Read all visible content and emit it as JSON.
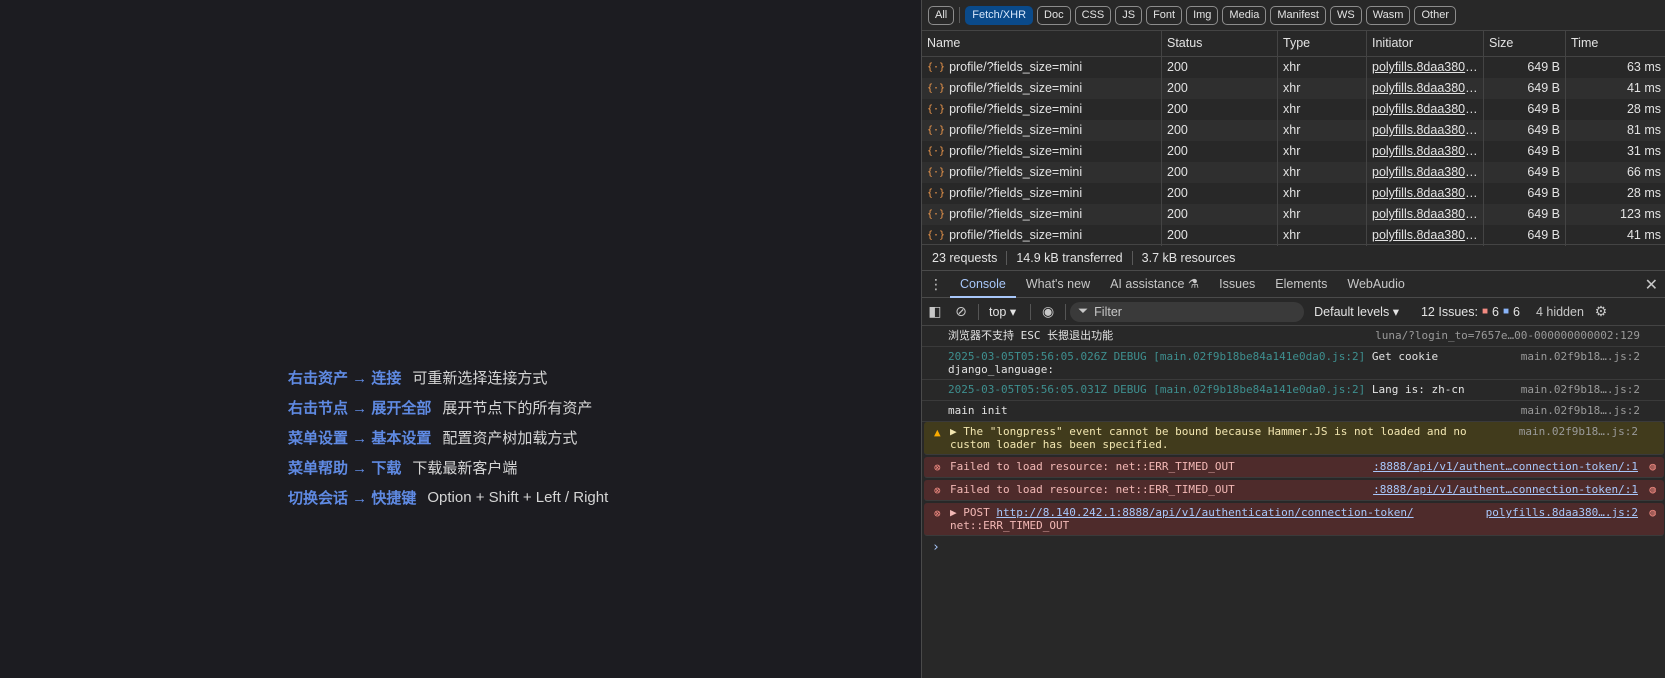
{
  "app": {
    "shortcuts": [
      {
        "command": "右击资产 → 连接",
        "description": "可重新选择连接方式"
      },
      {
        "command": "右击节点 → 展开全部",
        "description": "展开节点下的所有资产"
      },
      {
        "command": "菜单设置 → 基本设置",
        "description": "配置资产树加载方式"
      },
      {
        "command": "菜单帮助 → 下载",
        "description": "下载最新客户端"
      },
      {
        "command": "切换会话 → 快捷键",
        "description": "Option + Shift + Left / Right"
      }
    ]
  },
  "network": {
    "filters": [
      "All",
      "Fetch/XHR",
      "Doc",
      "CSS",
      "JS",
      "Font",
      "Img",
      "Media",
      "Manifest",
      "WS",
      "Wasm",
      "Other"
    ],
    "active_filter": "Fetch/XHR",
    "columns": [
      "Name",
      "Status",
      "Type",
      "Initiator",
      "Size",
      "Time"
    ],
    "rows": [
      {
        "name": "profile/?fields_size=mini",
        "status": "200",
        "type": "xhr",
        "initiator": "polyfills.8daa380....",
        "size": "649 B",
        "time": "63 ms"
      },
      {
        "name": "profile/?fields_size=mini",
        "status": "200",
        "type": "xhr",
        "initiator": "polyfills.8daa380....",
        "size": "649 B",
        "time": "41 ms"
      },
      {
        "name": "profile/?fields_size=mini",
        "status": "200",
        "type": "xhr",
        "initiator": "polyfills.8daa380....",
        "size": "649 B",
        "time": "28 ms"
      },
      {
        "name": "profile/?fields_size=mini",
        "status": "200",
        "type": "xhr",
        "initiator": "polyfills.8daa380....",
        "size": "649 B",
        "time": "81 ms"
      },
      {
        "name": "profile/?fields_size=mini",
        "status": "200",
        "type": "xhr",
        "initiator": "polyfills.8daa380....",
        "size": "649 B",
        "time": "31 ms"
      },
      {
        "name": "profile/?fields_size=mini",
        "status": "200",
        "type": "xhr",
        "initiator": "polyfills.8daa380....",
        "size": "649 B",
        "time": "66 ms"
      },
      {
        "name": "profile/?fields_size=mini",
        "status": "200",
        "type": "xhr",
        "initiator": "polyfills.8daa380....",
        "size": "649 B",
        "time": "28 ms"
      },
      {
        "name": "profile/?fields_size=mini",
        "status": "200",
        "type": "xhr",
        "initiator": "polyfills.8daa380....",
        "size": "649 B",
        "time": "123 ms"
      },
      {
        "name": "profile/?fields_size=mini",
        "status": "200",
        "type": "xhr",
        "initiator": "polyfills.8daa380....",
        "size": "649 B",
        "time": "41 ms"
      }
    ],
    "summary": {
      "requests": "23 requests",
      "transferred": "14.9 kB transferred",
      "resources": "3.7 kB resources"
    }
  },
  "drawer": {
    "tabs": [
      "Console",
      "What's new",
      "AI assistance",
      "Issues",
      "Elements",
      "WebAudio"
    ],
    "active_tab": "Console"
  },
  "console_toolbar": {
    "context": "top",
    "filter_placeholder": "Filter",
    "levels": "Default levels",
    "issues_label": "12 Issues:",
    "issues_errors": "6",
    "issues_info": "6",
    "hidden": "4 hidden"
  },
  "console_logs": [
    {
      "level": "info",
      "text": "浏览器不支持 ESC 长摁退出功能",
      "source": "luna/?login_to=7657e…00-000000000002:129"
    },
    {
      "level": "debug",
      "prefix": "2025-03-05T05:56:05.026Z DEBUG [main.02f9b18be84a141e0da0.js:2]",
      "text": "Get cookie",
      "text2": "django_language:",
      "source": "main.02f9b18….js:2"
    },
    {
      "level": "debug",
      "prefix": "2025-03-05T05:56:05.031Z DEBUG [main.02f9b18be84a141e0da0.js:2]",
      "text": "Lang is:  zh-cn",
      "source": "main.02f9b18….js:2"
    },
    {
      "level": "info",
      "text": "main init",
      "source": "main.02f9b18….js:2"
    },
    {
      "level": "warn",
      "text": "The \"longpress\" event cannot be bound because Hammer.JS is not loaded and no",
      "text2": "custom loader has been specified.",
      "source": "main.02f9b18….js:2"
    },
    {
      "level": "error",
      "text": "Failed to load resource: net::ERR_TIMED_OUT",
      "source": ":8888/api/v1/authent…connection-token/:1"
    },
    {
      "level": "error",
      "text": "Failed to load resource: net::ERR_TIMED_OUT",
      "source": ":8888/api/v1/authent…connection-token/:1"
    },
    {
      "level": "error",
      "method": "POST",
      "url": "http://8.140.242.1:8888/api/v1/authentication/connection-token/",
      "text2": "net::ERR_TIMED_OUT",
      "source": "polyfills.8daa380….js:2"
    }
  ]
}
